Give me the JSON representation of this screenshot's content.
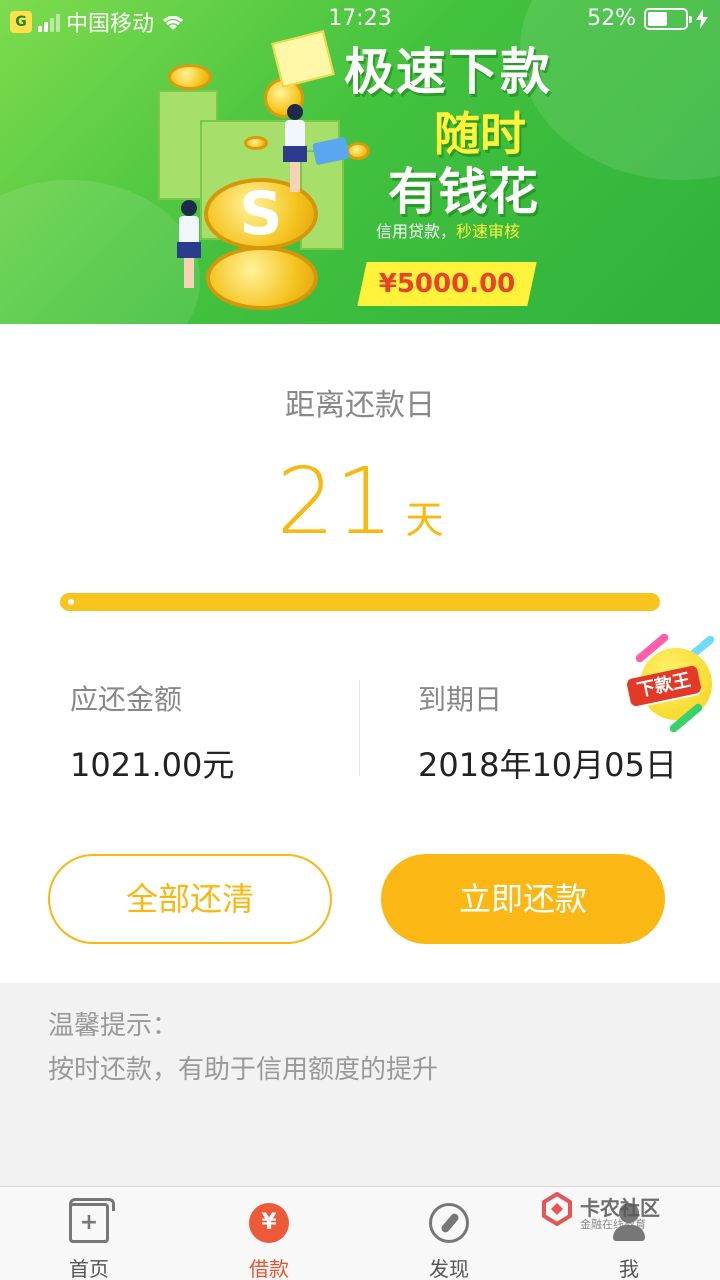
{
  "status_bar": {
    "carrier": "中国移动",
    "time": "17:23",
    "battery": "52%",
    "battery_level": 0.52
  },
  "banner": {
    "title_line1": "极速下款",
    "title_line2": "随时",
    "title_line3": "有钱花",
    "subtitle_prefix": "信用贷款，",
    "subtitle_highlight": "秒速审核",
    "amount": "¥5000.00",
    "coin_symbol": "S"
  },
  "countdown": {
    "label": "距离还款日",
    "days": "21",
    "unit": "天",
    "progress": 0.0
  },
  "info": {
    "amount_label": "应还金额",
    "amount_value": "1021.00元",
    "due_label": "到期日",
    "due_value": "2018年10月05日"
  },
  "badge": {
    "text": "下款王"
  },
  "buttons": {
    "repay_all": "全部还清",
    "repay_now": "立即还款"
  },
  "tips": {
    "title": "温馨提示：",
    "body": "按时还款，有助于信用额度的提升"
  },
  "tabs": [
    {
      "label": "首页",
      "icon": "home-icon"
    },
    {
      "label": "借款",
      "icon": "yuan-icon",
      "active": true
    },
    {
      "label": "发现",
      "icon": "compass-icon"
    },
    {
      "label": "我",
      "icon": "user-icon"
    }
  ],
  "watermark": {
    "name": "卡农社区",
    "tagline": "金融在线教育"
  },
  "colors": {
    "accent": "#f9b810",
    "banner_green": "#43c23e",
    "tab_active": "#e8542f",
    "amount_red": "#e8412c"
  }
}
